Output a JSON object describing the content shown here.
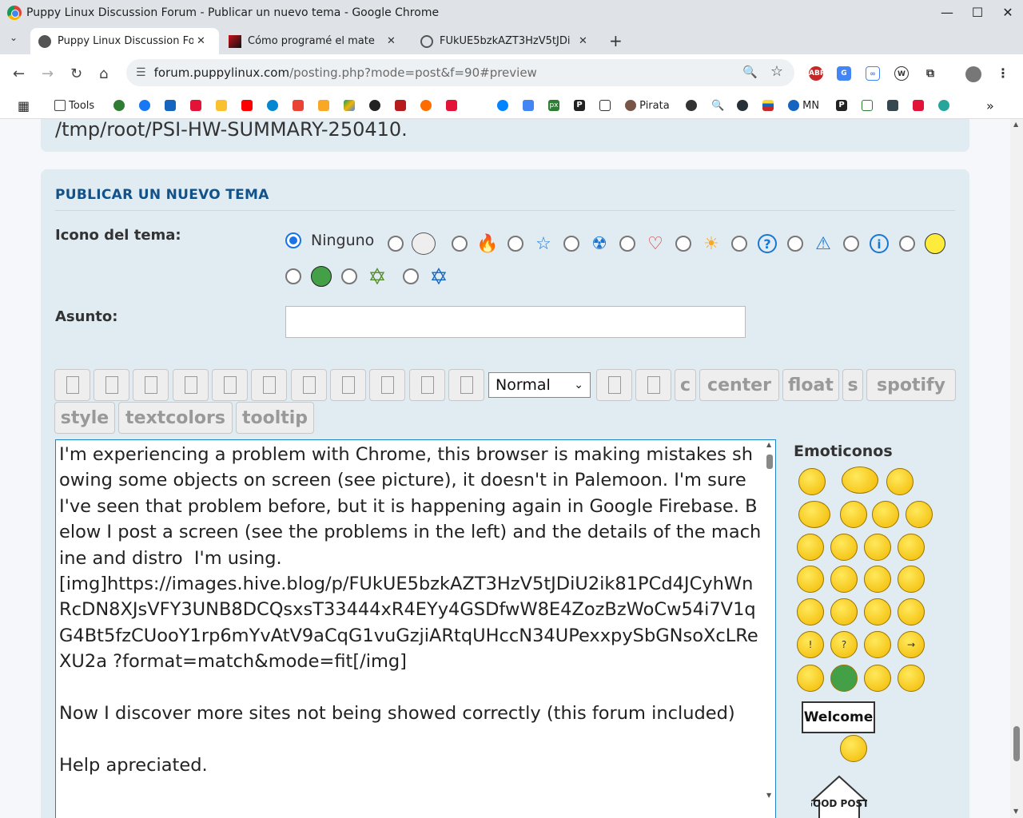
{
  "window": {
    "title": "Puppy Linux Discussion Forum - Publicar un nuevo tema - Google Chrome",
    "controls": [
      "—",
      "☐",
      "✕"
    ]
  },
  "tabs": [
    {
      "label": "Puppy Linux Discussion Fo",
      "active": true
    },
    {
      "label": "Cómo programé el mate",
      "active": false
    },
    {
      "label": "FUkUE5bzkAZT3HzV5tJDi",
      "active": false
    }
  ],
  "address": {
    "domain": "forum.puppylinux.com",
    "path": "/posting.php?mode=post&f=90#preview"
  },
  "bookmarks": {
    "tools_label": "Tools",
    "pirata_label": "Pirata",
    "mn_label": "MN",
    "p_label": "P",
    "px_label": "px"
  },
  "extensions": {
    "abp_label": "ABP"
  },
  "prev_panel": {
    "text": "/tmp/root/PSI-HW-SUMMARY-250410."
  },
  "form": {
    "heading": "PUBLICAR UN NUEVO TEMA",
    "icon_label": "Icono del tema:",
    "icon_none_label": "Ninguno",
    "subject_label": "Asunto:",
    "subject_value": "",
    "font_size_selected": "Normal",
    "buttons": {
      "c": "c",
      "center": "center",
      "float": "float",
      "s": "s",
      "spotify": "spotify",
      "style": "style",
      "textcolors": "textcolors",
      "tooltip": "tooltip"
    },
    "message": "I'm experiencing a problem with Chrome, this browser is making mistakes showing some objects on screen (see picture), it doesn't in Palemoon. I'm sure I've seen that problem before, but it is happening again in Google Firebase. Below I post a screen (see the problems in the left) and the details of the machine and distro  I'm using.\n[img]https://images.hive.blog/p/FUkUE5bzkAZT3HzV5tJDiU2ik81PCd4JCyhWnRcDN8XJsVFY3UNB8DCQsxsT33444xR4EYy4GSDfwW8E4ZozBzWoCw54i7V1qG4Bt5fzCUooY1rp6mYvAtV9aCqG1vuGzjiARtqUHccN34UPexxpySbGNsoXcLReXU2a ?format=match&mode=fit[/img]\n\nNow I discover more sites not being showed correctly (this forum included)\n\nHelp apreciated.",
    "smilies_title": "Emoticonos",
    "welcome_label": "Welcome",
    "goodpost_label": "GOOD POST!"
  }
}
